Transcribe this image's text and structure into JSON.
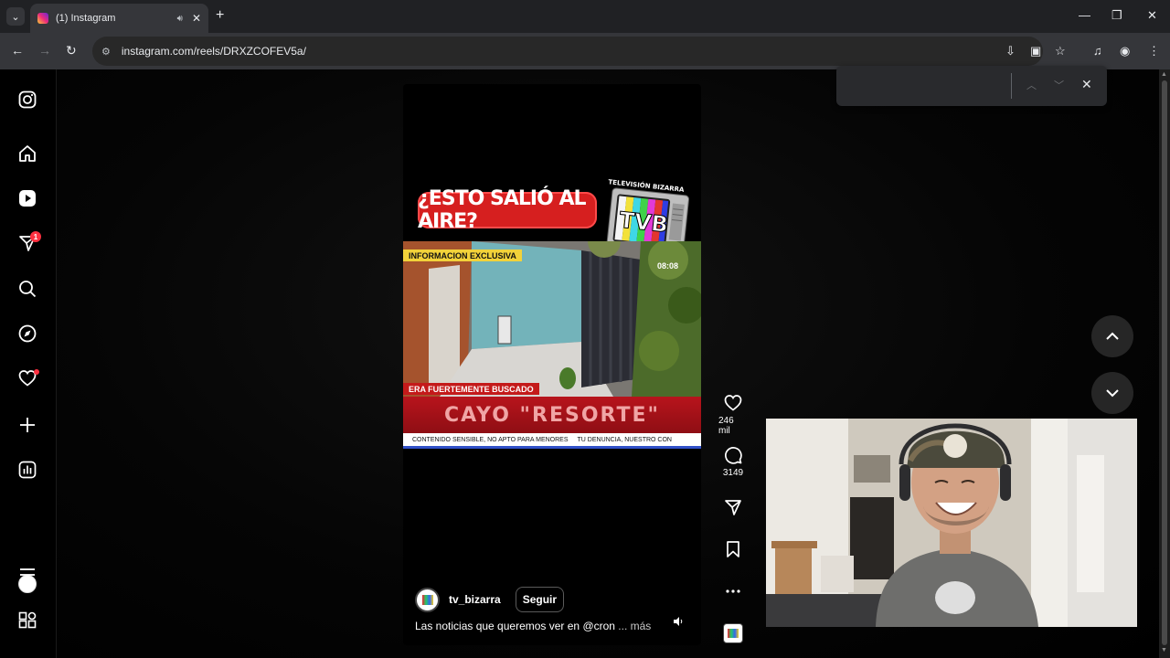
{
  "browser": {
    "tab_title": "(1) Instagram",
    "url": "instagram.com/reels/DRXZCOFEV5a/",
    "find_placeholder": ""
  },
  "sidebar": {
    "notification_badge": "1",
    "icons": [
      "instagram-logo-icon",
      "home-icon",
      "reels-icon",
      "direct-messages-icon",
      "search-icon",
      "explore-icon",
      "notifications-icon",
      "create-icon",
      "dashboard-icon",
      "profile-avatar",
      "menu-icon",
      "also-from-meta-icon"
    ]
  },
  "reel": {
    "headline": "¿ESTO SALIÓ AL AIRE?",
    "brand_label": "TELEVISIÓN BIZARRA",
    "brand_logo": "TVB",
    "exclusive_tag": "INFORMACION EXCLUSIVA",
    "clock": "08:08",
    "lower_tag": "ERA FUERTEMENTE BUSCADO",
    "lower_title": "CAYO \"RESORTE\"",
    "ticker_1": "CONTENIDO SENSIBLE, NO APTO PARA MENORES",
    "ticker_2": "TU DENUNCIA, NUESTRO CON",
    "username": "tv_bizarra",
    "follow_label": "Seguir",
    "caption": "Las noticias que queremos ver en @cron",
    "caption_more": " ... más"
  },
  "actions": {
    "likes": "246 mil",
    "comments": "3149"
  },
  "colors": {
    "accent_red": "#ff3040",
    "headline_red": "#d61f1f",
    "tag_yellow": "#f2d23a",
    "chrome_dark": "#202124"
  }
}
